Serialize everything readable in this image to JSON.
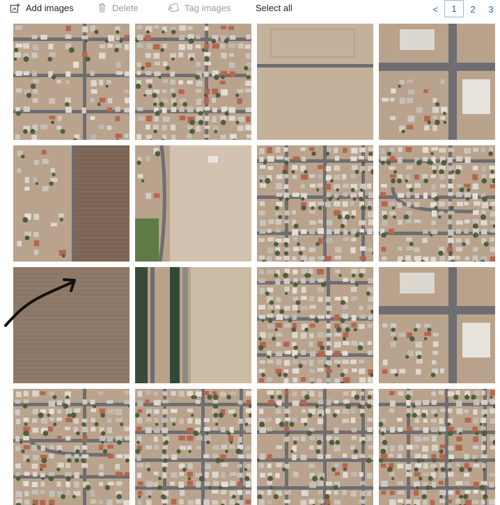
{
  "toolbar": {
    "add_images": {
      "label": "Add images",
      "icon": "add-image-icon"
    },
    "delete": {
      "label": "Delete",
      "icon": "trash-icon",
      "disabled": true
    },
    "tag_images": {
      "label": "Tag images",
      "icon": "tag-icon",
      "disabled": true
    },
    "select_all": {
      "label": "Select all"
    }
  },
  "pagination": {
    "prev_label": "<",
    "pages": [
      "1",
      "2",
      "3"
    ],
    "current_page": "1"
  },
  "image_grid": {
    "columns": 4,
    "rows": 4,
    "tiles": [
      {
        "kind": "residential-sparse"
      },
      {
        "kind": "residential-mixed"
      },
      {
        "kind": "vacant-lot"
      },
      {
        "kind": "intersection-commercial"
      },
      {
        "kind": "field-edge"
      },
      {
        "kind": "dirt-lot-road"
      },
      {
        "kind": "residential-grid"
      },
      {
        "kind": "residential-curved"
      },
      {
        "kind": "bare-field"
      },
      {
        "kind": "canal-field"
      },
      {
        "kind": "residential-rows"
      },
      {
        "kind": "commercial-intersection"
      },
      {
        "kind": "residential-cul-de-sac"
      },
      {
        "kind": "residential-dense"
      },
      {
        "kind": "residential-dense-grid"
      },
      {
        "kind": "residential-dense-2"
      }
    ]
  },
  "colors": {
    "link": "#2b5fb3",
    "disabled_text": "#9a9a9a",
    "ground": "#b9a38c",
    "field": "#8a7563",
    "road": "#6e6e72",
    "roof": "#d8d0c6",
    "tree": "#4f5e3b"
  }
}
